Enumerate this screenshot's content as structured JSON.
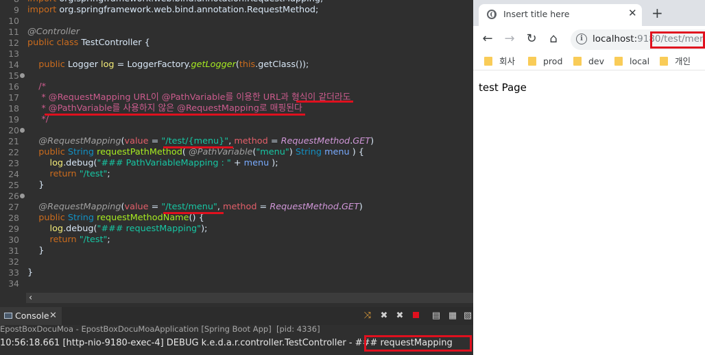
{
  "editor": {
    "lines": [
      {
        "num": "8",
        "parts": [
          [
            "kw",
            "import "
          ],
          [
            "gray",
            "org.springframework.web.bind.annotation.RequestMapping;"
          ]
        ]
      },
      {
        "num": "9",
        "parts": [
          [
            "kw",
            "import "
          ],
          [
            "gray",
            "org.springframework.web.bind.annotation.RequestMethod;"
          ]
        ]
      },
      {
        "num": "10",
        "parts": []
      },
      {
        "num": "11",
        "parts": [
          [
            "an",
            "@Controller"
          ]
        ]
      },
      {
        "num": "12",
        "parts": [
          [
            "kw",
            "public class "
          ],
          [
            "gray",
            "TestController {"
          ]
        ]
      },
      {
        "num": "13",
        "parts": []
      },
      {
        "num": "14",
        "parts": [
          [
            "kw",
            "    public "
          ],
          [
            "gray",
            "Logger "
          ],
          [
            "var",
            "log "
          ],
          [
            "gray",
            "= LoggerFactory."
          ],
          [
            "fi",
            "getLogger"
          ],
          [
            "gray",
            "("
          ],
          [
            "kw",
            "this"
          ],
          [
            "gray",
            ".getClass());"
          ]
        ]
      },
      {
        "num": "15",
        "parts": []
      },
      {
        "num": "16",
        "parts": [
          [
            "cm",
            "    /*"
          ]
        ]
      },
      {
        "num": "17",
        "parts": [
          [
            "cm",
            "     * @RequestMapping URL이 @PathVariable를 이용한 URL과 형식이 같더라도"
          ]
        ]
      },
      {
        "num": "18",
        "parts": [
          [
            "cm",
            "     * @PathVariable를 사용하지 않은 @RequestMapping로 매핑된다"
          ]
        ]
      },
      {
        "num": "19",
        "parts": [
          [
            "cm",
            "     */"
          ]
        ]
      },
      {
        "num": "20",
        "parts": []
      },
      {
        "num": "21",
        "parts": [
          [
            "an",
            "    @RequestMapping"
          ],
          [
            "gray",
            "("
          ],
          [
            "attr",
            "value"
          ],
          [
            "gray",
            " = "
          ],
          [
            "str",
            "\"/test/{menu}\""
          ],
          [
            "gray",
            ", "
          ],
          [
            "attr",
            "method"
          ],
          [
            "gray",
            " = "
          ],
          [
            "it",
            "RequestMethod"
          ],
          [
            "gray",
            "."
          ],
          [
            "it",
            "GET"
          ],
          [
            "gray",
            ")"
          ]
        ]
      },
      {
        "num": "22",
        "parts": [
          [
            "kw",
            "    public "
          ],
          [
            "ty",
            "String "
          ],
          [
            "fn",
            "requestPathMethod"
          ],
          [
            "gray",
            "( "
          ],
          [
            "an",
            "@PathVariable"
          ],
          [
            "gray",
            "("
          ],
          [
            "str",
            "\"menu\""
          ],
          [
            "gray",
            ") "
          ],
          [
            "ty",
            "String "
          ],
          [
            "lg",
            "menu"
          ],
          [
            "gray",
            " ) {"
          ]
        ]
      },
      {
        "num": "23",
        "parts": [
          [
            "var",
            "        log"
          ],
          [
            "gray",
            "."
          ],
          [
            "gray",
            "debug("
          ],
          [
            "str",
            "\"### PathVariableMapping : \""
          ],
          [
            "gray",
            " + "
          ],
          [
            "lg",
            "menu"
          ],
          [
            "gray",
            " );"
          ]
        ]
      },
      {
        "num": "24",
        "parts": [
          [
            "kw",
            "        return "
          ],
          [
            "str",
            "\"/test\""
          ],
          [
            "gray",
            ";"
          ]
        ]
      },
      {
        "num": "25",
        "parts": [
          [
            "gray",
            "    }"
          ]
        ]
      },
      {
        "num": "26",
        "parts": []
      },
      {
        "num": "27",
        "parts": [
          [
            "an",
            "    @RequestMapping"
          ],
          [
            "gray",
            "("
          ],
          [
            "attr",
            "value"
          ],
          [
            "gray",
            " = "
          ],
          [
            "str",
            "\"/test/menu\""
          ],
          [
            "gray",
            ", "
          ],
          [
            "attr",
            "method"
          ],
          [
            "gray",
            " = "
          ],
          [
            "it",
            "RequestMethod"
          ],
          [
            "gray",
            "."
          ],
          [
            "it",
            "GET"
          ],
          [
            "gray",
            ")"
          ]
        ]
      },
      {
        "num": "28",
        "parts": [
          [
            "kw",
            "    public "
          ],
          [
            "ty",
            "String "
          ],
          [
            "fn",
            "requestMethodName"
          ],
          [
            "gray",
            "() {"
          ]
        ]
      },
      {
        "num": "29",
        "parts": [
          [
            "var",
            "        log"
          ],
          [
            "gray",
            "."
          ],
          [
            "gray",
            "debug("
          ],
          [
            "str",
            "\"### requestMapping\""
          ],
          [
            "gray",
            ");"
          ]
        ]
      },
      {
        "num": "30",
        "parts": [
          [
            "kw",
            "        return "
          ],
          [
            "str",
            "\"/test\""
          ],
          [
            "gray",
            ";"
          ]
        ]
      },
      {
        "num": "31",
        "parts": [
          [
            "gray",
            "    }"
          ]
        ]
      },
      {
        "num": "32",
        "parts": []
      },
      {
        "num": "33",
        "parts": [
          [
            "gray",
            "}"
          ]
        ]
      },
      {
        "num": "34",
        "parts": []
      }
    ],
    "scroll_left_icon": "‹"
  },
  "console": {
    "tab_label": "Console",
    "tab_close": "✕",
    "status": "EpostBoxDocuMoa - EpostBoxDocuMoaApplication [Spring Boot App]  [pid: 4336]",
    "log": "10:56:18.661 [http-nio-9180-exec-4] DEBUG k.e.d.a.r.controller.TestController - ### requestMapping",
    "toolbar_icons": [
      "pin-icon",
      "remove-launch-icon",
      "remove-all-icon",
      "terminate-icon",
      "clear-console-icon",
      "scroll-lock-icon",
      "word-wrap-icon"
    ]
  },
  "browser": {
    "tab_title": "Insert title here",
    "tab_close": "✕",
    "new_tab": "+",
    "url_host": "localhost:",
    "url_port": "9180",
    "url_path": "/test/menu",
    "bookmarks": [
      "회사",
      "prod",
      "dev",
      "local",
      "개인"
    ],
    "page_text": "test Page",
    "folder_color": "#f9cc58"
  }
}
